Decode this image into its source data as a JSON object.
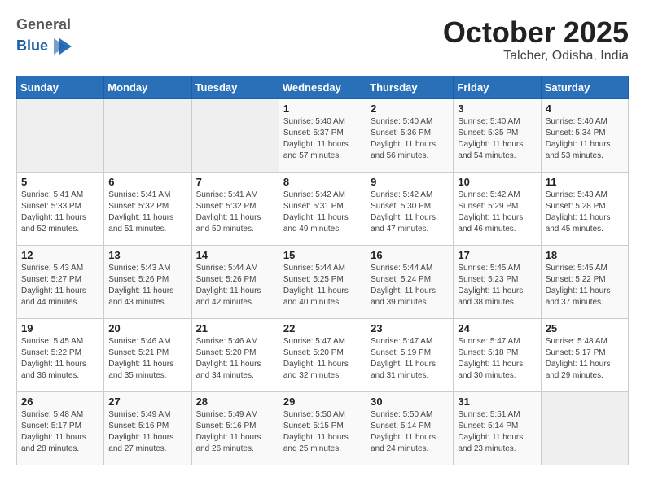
{
  "header": {
    "logo_line1": "General",
    "logo_line2": "Blue",
    "month": "October 2025",
    "location": "Talcher, Odisha, India"
  },
  "weekdays": [
    "Sunday",
    "Monday",
    "Tuesday",
    "Wednesday",
    "Thursday",
    "Friday",
    "Saturday"
  ],
  "weeks": [
    [
      {
        "day": "",
        "info": ""
      },
      {
        "day": "",
        "info": ""
      },
      {
        "day": "",
        "info": ""
      },
      {
        "day": "1",
        "info": "Sunrise: 5:40 AM\nSunset: 5:37 PM\nDaylight: 11 hours\nand 57 minutes."
      },
      {
        "day": "2",
        "info": "Sunrise: 5:40 AM\nSunset: 5:36 PM\nDaylight: 11 hours\nand 56 minutes."
      },
      {
        "day": "3",
        "info": "Sunrise: 5:40 AM\nSunset: 5:35 PM\nDaylight: 11 hours\nand 54 minutes."
      },
      {
        "day": "4",
        "info": "Sunrise: 5:40 AM\nSunset: 5:34 PM\nDaylight: 11 hours\nand 53 minutes."
      }
    ],
    [
      {
        "day": "5",
        "info": "Sunrise: 5:41 AM\nSunset: 5:33 PM\nDaylight: 11 hours\nand 52 minutes."
      },
      {
        "day": "6",
        "info": "Sunrise: 5:41 AM\nSunset: 5:32 PM\nDaylight: 11 hours\nand 51 minutes."
      },
      {
        "day": "7",
        "info": "Sunrise: 5:41 AM\nSunset: 5:32 PM\nDaylight: 11 hours\nand 50 minutes."
      },
      {
        "day": "8",
        "info": "Sunrise: 5:42 AM\nSunset: 5:31 PM\nDaylight: 11 hours\nand 49 minutes."
      },
      {
        "day": "9",
        "info": "Sunrise: 5:42 AM\nSunset: 5:30 PM\nDaylight: 11 hours\nand 47 minutes."
      },
      {
        "day": "10",
        "info": "Sunrise: 5:42 AM\nSunset: 5:29 PM\nDaylight: 11 hours\nand 46 minutes."
      },
      {
        "day": "11",
        "info": "Sunrise: 5:43 AM\nSunset: 5:28 PM\nDaylight: 11 hours\nand 45 minutes."
      }
    ],
    [
      {
        "day": "12",
        "info": "Sunrise: 5:43 AM\nSunset: 5:27 PM\nDaylight: 11 hours\nand 44 minutes."
      },
      {
        "day": "13",
        "info": "Sunrise: 5:43 AM\nSunset: 5:26 PM\nDaylight: 11 hours\nand 43 minutes."
      },
      {
        "day": "14",
        "info": "Sunrise: 5:44 AM\nSunset: 5:26 PM\nDaylight: 11 hours\nand 42 minutes."
      },
      {
        "day": "15",
        "info": "Sunrise: 5:44 AM\nSunset: 5:25 PM\nDaylight: 11 hours\nand 40 minutes."
      },
      {
        "day": "16",
        "info": "Sunrise: 5:44 AM\nSunset: 5:24 PM\nDaylight: 11 hours\nand 39 minutes."
      },
      {
        "day": "17",
        "info": "Sunrise: 5:45 AM\nSunset: 5:23 PM\nDaylight: 11 hours\nand 38 minutes."
      },
      {
        "day": "18",
        "info": "Sunrise: 5:45 AM\nSunset: 5:22 PM\nDaylight: 11 hours\nand 37 minutes."
      }
    ],
    [
      {
        "day": "19",
        "info": "Sunrise: 5:45 AM\nSunset: 5:22 PM\nDaylight: 11 hours\nand 36 minutes."
      },
      {
        "day": "20",
        "info": "Sunrise: 5:46 AM\nSunset: 5:21 PM\nDaylight: 11 hours\nand 35 minutes."
      },
      {
        "day": "21",
        "info": "Sunrise: 5:46 AM\nSunset: 5:20 PM\nDaylight: 11 hours\nand 34 minutes."
      },
      {
        "day": "22",
        "info": "Sunrise: 5:47 AM\nSunset: 5:20 PM\nDaylight: 11 hours\nand 32 minutes."
      },
      {
        "day": "23",
        "info": "Sunrise: 5:47 AM\nSunset: 5:19 PM\nDaylight: 11 hours\nand 31 minutes."
      },
      {
        "day": "24",
        "info": "Sunrise: 5:47 AM\nSunset: 5:18 PM\nDaylight: 11 hours\nand 30 minutes."
      },
      {
        "day": "25",
        "info": "Sunrise: 5:48 AM\nSunset: 5:17 PM\nDaylight: 11 hours\nand 29 minutes."
      }
    ],
    [
      {
        "day": "26",
        "info": "Sunrise: 5:48 AM\nSunset: 5:17 PM\nDaylight: 11 hours\nand 28 minutes."
      },
      {
        "day": "27",
        "info": "Sunrise: 5:49 AM\nSunset: 5:16 PM\nDaylight: 11 hours\nand 27 minutes."
      },
      {
        "day": "28",
        "info": "Sunrise: 5:49 AM\nSunset: 5:16 PM\nDaylight: 11 hours\nand 26 minutes."
      },
      {
        "day": "29",
        "info": "Sunrise: 5:50 AM\nSunset: 5:15 PM\nDaylight: 11 hours\nand 25 minutes."
      },
      {
        "day": "30",
        "info": "Sunrise: 5:50 AM\nSunset: 5:14 PM\nDaylight: 11 hours\nand 24 minutes."
      },
      {
        "day": "31",
        "info": "Sunrise: 5:51 AM\nSunset: 5:14 PM\nDaylight: 11 hours\nand 23 minutes."
      },
      {
        "day": "",
        "info": ""
      }
    ]
  ]
}
